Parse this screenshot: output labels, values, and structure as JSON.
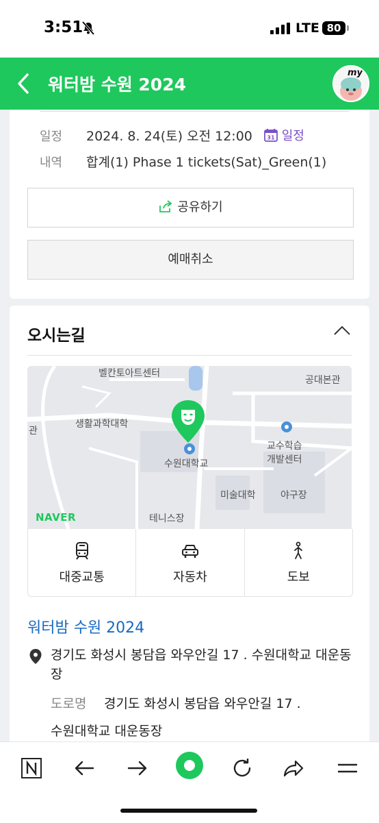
{
  "status_bar": {
    "time": "3:51",
    "network": "LTE",
    "battery": "80"
  },
  "header": {
    "title": "워터밤 수원 2024",
    "avatar_text": "my"
  },
  "booking": {
    "date_label": "일정",
    "date_value": "2024. 8. 24(토) 오전 12:00",
    "calendar_link": "일정",
    "detail_label": "내역",
    "detail_value": "합계(1) Phase 1 tickets(Sat)_Green(1)",
    "share_button": "공유하기",
    "cancel_button": "예매취소"
  },
  "directions": {
    "title": "오시는길",
    "map_labels": {
      "arts_center": "벨칸토아트센터",
      "engineering": "공대본관",
      "life_science": "생활과학대학",
      "partial": "관",
      "teaching": "교수학습",
      "dev_center": "개발센터",
      "university": "수원대학교",
      "art_college": "미술대학",
      "ballpark": "야구장",
      "tennis": "테니스장"
    },
    "map_brand": "NAVER",
    "transport": [
      {
        "label": "대중교통",
        "icon": "bus-icon"
      },
      {
        "label": "자동차",
        "icon": "car-icon"
      },
      {
        "label": "도보",
        "icon": "walk-icon"
      }
    ],
    "place_name": "워터밤 수원 2024",
    "address": "경기도 화성시 봉담읍 와우안길 17 . 수원대학교 대운동장",
    "road_label": "도로명",
    "road_address_line1": "경기도 화성시 봉담읍 와우안길 17 .",
    "road_address_line2": "수원대학교 대운동장"
  },
  "colors": {
    "brand_green": "#1ec85c",
    "link_blue": "#1769c2",
    "calendar_purple": "#7b4fc7"
  }
}
